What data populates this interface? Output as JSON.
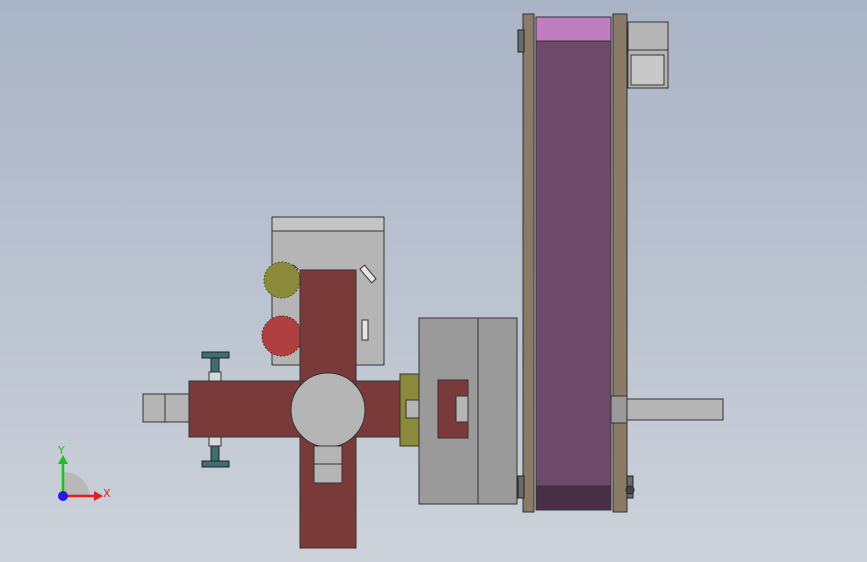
{
  "colors": {
    "background_top": "#a9b4c6",
    "background_bottom": "#cdd2da",
    "frame_brown": "#7a3a3a",
    "belt_purple": "#6e4a6a",
    "belt_highlight": "#c07ec0",
    "housing_gray": "#9a9a9a",
    "plate_gray": "#b5b5b5",
    "rail_tan": "#8a7a66",
    "gear_olive": "#8a8a3a",
    "teal_knob": "#3e6e6e",
    "axis_x": "#e02020",
    "axis_y": "#20c020",
    "axis_z": "#2020e0"
  },
  "axes": {
    "x_label": "X",
    "y_label": "Y"
  }
}
